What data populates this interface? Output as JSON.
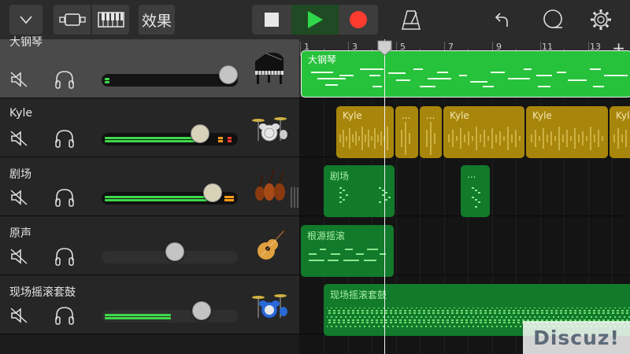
{
  "toolbar": {
    "effects_label": "效果"
  },
  "tracks": [
    {
      "name": "大钢琴",
      "instrument": "grand-piano",
      "selected": true,
      "volume": 0.92
    },
    {
      "name": "Kyle",
      "instrument": "drum-kit",
      "selected": false,
      "volume": 0.7
    },
    {
      "name": "剧场",
      "instrument": "strings",
      "selected": false,
      "volume": 0.8
    },
    {
      "name": "原声",
      "instrument": "acoustic-guitar",
      "selected": false,
      "volume": 0.55
    },
    {
      "name": "现场摇滚套鼓",
      "instrument": "drum-kit-blue",
      "selected": false,
      "volume": 0.74
    }
  ],
  "ruler": {
    "labels": [
      "1",
      "3",
      "5",
      "7",
      "9",
      "11",
      "13"
    ]
  },
  "regions": {
    "piano": "大钢琴",
    "kyle1": "Kyle",
    "dots1": "...",
    "dots2": "...",
    "kyle2": "Kyle",
    "kyle3": "Kyle",
    "kyle4": "Kyle",
    "theater1": "剧场",
    "theater2": "...",
    "acoustic": "根源摇滚",
    "rock": "现场摇滚套鼓"
  },
  "watermark": "Discuz!",
  "colors": {
    "accent_green": "#26c23b",
    "region_dark_green": "#117a2b",
    "region_gold": "#a8860c",
    "record_red": "#ff3b30"
  }
}
